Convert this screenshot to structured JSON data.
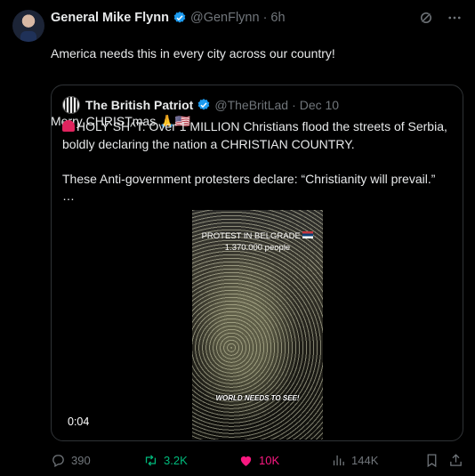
{
  "tweet": {
    "author_name": "General Mike Flynn",
    "handle": "@GenFlynn",
    "separator": "·",
    "time": "6h",
    "text_line1": "America needs this in every city across our country!",
    "text_line2": "Merry CHRISTmas 🙏🇺🇸"
  },
  "quote": {
    "author_name": "The British Patriot",
    "handle": "@TheBritLad",
    "separator": "·",
    "date": "Dec 10",
    "text": "HOLY SH^T: Over 1 MILLION Christians flood the streets of Serbia, boldly declaring the nation a CHRISTIAN COUNTRY.\n\nThese Anti-government protesters declare: “Christianity will prevail.”\n…",
    "video": {
      "title_line1": "PROTEST IN BELGRADE",
      "title_line2": "1.370.000 people",
      "caption": "WORLD NEEDS TO SEE!",
      "duration": "0:04"
    }
  },
  "actions": {
    "replies": "390",
    "reposts": "3.2K",
    "likes": "10K",
    "views": "144K"
  },
  "colors": {
    "verified": "#1d9bf0",
    "repost": "#00ba7c",
    "like": "#f91880",
    "muted": "#71767b"
  },
  "icons": [
    "grok-icon",
    "more-icon",
    "reply-icon",
    "repost-icon",
    "heart-icon",
    "views-icon",
    "bookmark-icon",
    "share-icon",
    "verified-badge-icon",
    "siren-emoji-icon"
  ]
}
